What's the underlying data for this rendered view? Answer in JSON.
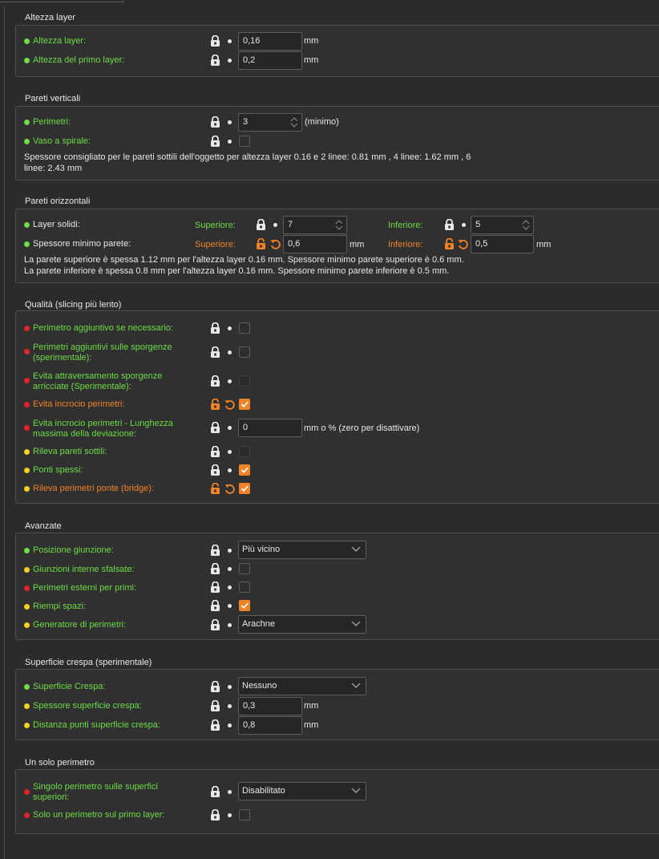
{
  "sections": {
    "layer_height": {
      "title": "Altezza layer",
      "rows": [
        {
          "label": "Altezza layer:",
          "value": "0,16",
          "unit": "mm"
        },
        {
          "label": "Altezza del primo layer:",
          "value": "0,2",
          "unit": "mm"
        }
      ]
    },
    "vertical_shells": {
      "title": "Pareti verticali",
      "perimeters": {
        "label": "Perimetri:",
        "value": "3",
        "suffix": "(minimo)"
      },
      "spiral_vase": {
        "label": "Vaso a spirale:",
        "checked": false
      },
      "note": "Spessore consigliato per le pareti sottili dell'oggetto per altezza layer 0.16 e 2 linee: 0.81 mm , 4 linee: 1.62 mm , 6 linee: 2.43 mm",
      "note_line1": "Spessore consigliato per le pareti sottili dell'oggetto per altezza layer 0.16 e 2 linee: 0.81 mm , 4 linee: 1.62 mm , 6",
      "note_line2": "linee: 2.43 mm"
    },
    "horizontal_shells": {
      "title": "Pareti orizzontali",
      "solid_layers": {
        "label": "Layer solidi:",
        "top_label": "Superiore:",
        "top_value": "7",
        "bottom_label": "Inferiore:",
        "bottom_value": "5"
      },
      "min_thickness": {
        "label": "Spessore minimo parete:",
        "top_label": "Superiore:",
        "top_value": "0,6",
        "top_unit": "mm",
        "bottom_label": "Inferiore:",
        "bottom_value": "0,5",
        "bottom_unit": "mm"
      },
      "note_line1": "La parete superiore è spessa 1.12 mm per l'altezza layer 0.16 mm. Spessore minimo parete superiore è 0.6 mm.",
      "note_line2": "La parete inferiore è spessa 0.8 mm per l'altezza layer 0.16 mm. Spessore minimo parete inferiore è 0.5 mm."
    },
    "quality": {
      "title": "Qualità (slicing più lento)",
      "extra_perimeters": {
        "label": "Perimetro aggiuntivo se necessario:",
        "checked": false
      },
      "extra_perimeters_overhangs": {
        "line1": "Perimetri aggiuntivi sulle sporgenze",
        "line2": "(sperimentale):",
        "checked": false
      },
      "avoid_crossing_curled": {
        "line1": "Evita attraversamento sporgenze",
        "line2": "arricciate (Sperimentale):",
        "checked": false
      },
      "avoid_crossing_perimeters": {
        "label": "Evita incrocio perimetri:",
        "checked": true
      },
      "avoid_crossing_max_detour": {
        "line1": "Evita incrocio perimetri - Lunghezza",
        "line2": "massima della deviazione:",
        "value": "0",
        "unit": "mm o % (zero per disattivare)"
      },
      "thin_walls": {
        "label": "Rileva pareti sottili:",
        "checked": false
      },
      "thick_bridges": {
        "label": "Ponti spessi:",
        "checked": true
      },
      "bridge_perimeters": {
        "label": "Rileva perimetri ponte (bridge):",
        "checked": true
      }
    },
    "advanced": {
      "title": "Avanzate",
      "seam_position": {
        "label": "Posizione giunzione:",
        "value": "Più vicino"
      },
      "staggered_seams": {
        "label": "Giunzioni interne sfalsate:",
        "checked": false
      },
      "external_first": {
        "label": "Perimetri esterni per primi:",
        "checked": false
      },
      "gap_fill": {
        "label": "Riempi spazi:",
        "checked": true
      },
      "perimeter_generator": {
        "label": "Generatore di perimetri:",
        "value": "Arachne"
      }
    },
    "fuzzy_skin": {
      "title": "Superficie crespa (sperimentale)",
      "fuzzy": {
        "label": "Superficie Crespa:",
        "value": "Nessuno"
      },
      "thickness": {
        "label": "Spessore superficie crespa:",
        "value": "0,3",
        "unit": "mm"
      },
      "point_distance": {
        "label": "Distanza punti superficie crespa:",
        "value": "0,8",
        "unit": "mm"
      }
    },
    "single_perimeter": {
      "title": "Un solo perimetro",
      "top_surfaces": {
        "line1": "Singolo perimetro sulle superfici",
        "line2": "superiori:",
        "value": "Disabilitato"
      },
      "first_layer": {
        "label": "Solo un perimetro sul primo layer:",
        "checked": false
      }
    }
  },
  "colors": {
    "accent": "#f08228",
    "simple": "#6ddc46",
    "advanced": "#f5d222",
    "expert": "#e2252b",
    "background": "#2b2b2b"
  },
  "icons": [
    "lock-closed-icon",
    "lock-open-icon",
    "undo-arrow-icon",
    "bullet-icon",
    "spin-arrows-icon",
    "chevron-down-icon"
  ]
}
